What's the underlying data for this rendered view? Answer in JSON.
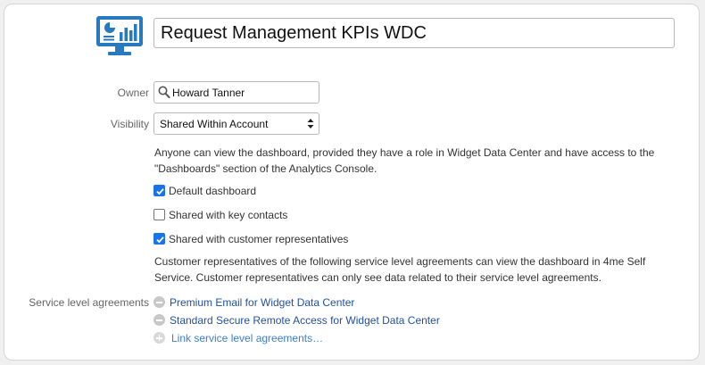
{
  "dashboard": {
    "title": "Request Management KPIs WDC",
    "icon": "dashboard-monitor-icon",
    "accent": "#2979bf"
  },
  "owner": {
    "label": "Owner",
    "value": "Howard Tanner"
  },
  "visibility": {
    "label": "Visibility",
    "selected": "Shared Within Account",
    "description_line1": "Anyone can view the dashboard, provided they have a role in Widget Data Center and have access to the",
    "description_line2": "\"Dashboards\" section of the Analytics Console."
  },
  "checkboxes": [
    {
      "label": "Default dashboard",
      "checked": true
    },
    {
      "label": "Shared with key contacts",
      "checked": false
    },
    {
      "label": "Shared with customer representatives",
      "checked": true
    }
  ],
  "customer_reps_note": {
    "line1": "Customer representatives of the following service level agreements can view the dashboard in 4me Self",
    "line2": "Service. Customer representatives can only see data related to their service level agreements."
  },
  "sla": {
    "label": "Service level agreements",
    "items": [
      "Premium Email for Widget Data Center",
      "Standard Secure Remote Access for Widget Data Center"
    ],
    "add_link": "Link service level agreements…"
  }
}
